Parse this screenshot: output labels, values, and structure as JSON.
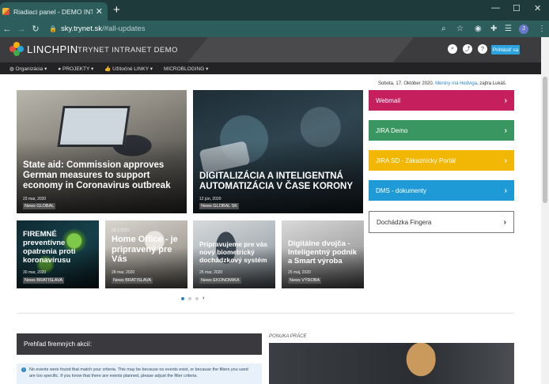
{
  "browser": {
    "tab_title": "Riadiaci panel - DEMO INTRANET",
    "url_host": "sky.trynet.sk",
    "url_path": "/#all-updates",
    "profile_initial": "J"
  },
  "header": {
    "brand": "LINCHPIN",
    "site_name": "TRYNET INTRANET DEMO",
    "login_label": "Prihlásiť sa"
  },
  "menu": [
    {
      "label": "Organizácia ▾",
      "icon": "globe-icon"
    },
    {
      "label": "PROJEKTY ▾",
      "icon": "lightbulb-icon"
    },
    {
      "label": "Užitočné LINKY ▾",
      "icon": "thumbs-up-icon"
    },
    {
      "label": "MICROBLOGING ▾",
      "icon": ""
    }
  ],
  "date_line": {
    "prefix": "Sobota, 17. Október 2020.",
    "link": "Meniny má Hedviga",
    "suffix": ", zajtra Lukáš."
  },
  "news_big": [
    {
      "headline": "State aid: Commission approves German measures to support economy in Coronavirus outbreak",
      "date": "23 mar, 2020",
      "tag": "News GLOBAL"
    },
    {
      "headline": "DIGITALIZÁCIA A INTELIGENTNÁ AUTOMATIZÁCIA V ČASE KORONY",
      "date": "12 jún, 2020",
      "tag": "News GLOBAL SK"
    }
  ],
  "news_small": [
    {
      "headline": "FIREMNÉ preventívne opatrenia proti koronavírusu",
      "date": "30 mar, 2020",
      "tag": "News BRATISLAVA"
    },
    {
      "headline": "Home Office - je pripravený pre Vás",
      "date": "28 mar, 2020",
      "tag": "News BRATISLAVA",
      "top_date": "28.3.2020"
    },
    {
      "headline": "Pripravujeme pre vás nový biometrický dochádzkový systém",
      "date": "25 mar, 2020",
      "tag": "News EKONOMIKA"
    },
    {
      "headline": "Digitálne dvojča - Inteligentný podnik a Smart výroba",
      "date": "25 máj, 2020",
      "tag": "News VÝROBA"
    }
  ],
  "tiles": [
    {
      "label": "Webmail",
      "color": "#c51f5d"
    },
    {
      "label": "JIRA Demo",
      "color": "#3a9660"
    },
    {
      "label": "JIRA SD - Zákaznícky Portál",
      "color": "#f2b705"
    },
    {
      "label": "DMS - dokumenty",
      "color": "#1e9bd7"
    },
    {
      "label": "Dochádzka Fingera",
      "color": "#ffffff"
    }
  ],
  "overview": {
    "title": "Prehľad firemných akcií:",
    "notice": "No events were found that match your criteria. This may be because no events exist, or because the filters you used are too specific. If you know that there are events planned, please adjust the filter criteria."
  },
  "jobs": {
    "label": "PONUKA PRÁCE"
  }
}
